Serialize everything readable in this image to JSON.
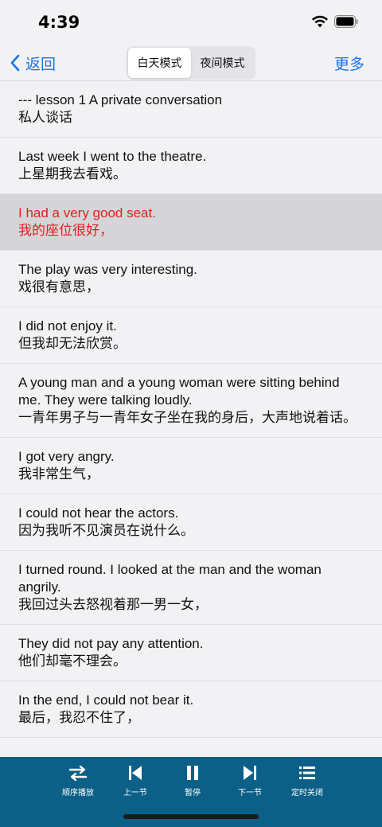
{
  "status": {
    "time": "4:39"
  },
  "nav": {
    "back_label": "返回",
    "segments": [
      "白天模式",
      "夜间模式"
    ],
    "active_segment": 0,
    "more_label": "更多"
  },
  "sentences": [
    {
      "en": "--- lesson 1 A private conversation",
      "zh": "私人谈话"
    },
    {
      "en": "Last week I went to the theatre.",
      "zh": "上星期我去看戏。"
    },
    {
      "en": "I had a very good seat.",
      "zh": "我的座位很好，"
    },
    {
      "en": "The play was very interesting.",
      "zh": "戏很有意思，"
    },
    {
      "en": "I did not enjoy it.",
      "zh": "但我却无法欣赏。"
    },
    {
      "en": "A young man and a young woman were sitting behind me. They were talking loudly.",
      "zh": "一青年男子与一青年女子坐在我的身后，大声地说着话。"
    },
    {
      "en": "I got very angry.",
      "zh": "我非常生气，"
    },
    {
      "en": "I could not hear the actors.",
      "zh": "因为我听不见演员在说什么。"
    },
    {
      "en": "I turned round. I looked at the man and the woman angrily.",
      "zh": "我回过头去怒视着那一男一女，"
    },
    {
      "en": "They did not pay any attention.",
      "zh": "他们却毫不理会。"
    },
    {
      "en": "In the end, I could not bear it.",
      "zh": "最后，我忍不住了，"
    }
  ],
  "highlight_index": 2,
  "colors": {
    "accent": "#1a73e8",
    "highlight_text": "#e0201d",
    "player_bg": "#0c5f86"
  },
  "player": {
    "order_label": "顺序播放",
    "prev_label": "上一节",
    "pause_label": "暂停",
    "next_label": "下一节",
    "timer_label": "定时关闭"
  },
  "icons": {
    "order": "shuffle-icon",
    "prev": "skip-back-icon",
    "pause": "pause-icon",
    "next": "skip-forward-icon",
    "timer": "list-icon"
  }
}
